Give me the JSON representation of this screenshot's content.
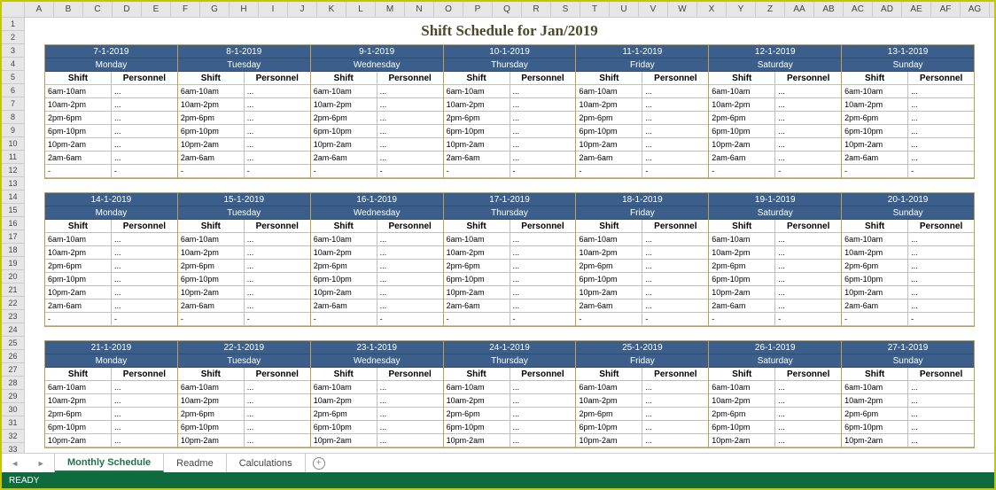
{
  "title": "Shift Schedule for Jan/2019",
  "columns": [
    "A",
    "B",
    "C",
    "D",
    "E",
    "F",
    "G",
    "H",
    "I",
    "J",
    "K",
    "L",
    "M",
    "N",
    "O",
    "P",
    "Q",
    "R",
    "S",
    "T",
    "U",
    "V",
    "W",
    "X",
    "Y",
    "Z",
    "AA",
    "AB",
    "AC",
    "AD",
    "AE",
    "AF",
    "AG"
  ],
  "rows_visible": 33,
  "col_hdrs": {
    "shift": "Shift",
    "personnel": "Personnel"
  },
  "shifts_full": [
    "6am-10am",
    "10am-2pm",
    "2pm-6pm",
    "6pm-10pm",
    "10pm-2am",
    "2am-6am",
    "-"
  ],
  "shifts_partial": [
    "6am-10am",
    "10am-2pm",
    "2pm-6pm",
    "6pm-10pm",
    "10pm-2am"
  ],
  "personnel_placeholder": "...",
  "dash": "-",
  "weeks": [
    {
      "days": [
        {
          "date": "7-1-2019",
          "name": "Monday"
        },
        {
          "date": "8-1-2019",
          "name": "Tuesday"
        },
        {
          "date": "9-1-2019",
          "name": "Wednesday"
        },
        {
          "date": "10-1-2019",
          "name": "Thursday"
        },
        {
          "date": "11-1-2019",
          "name": "Friday"
        },
        {
          "date": "12-1-2019",
          "name": "Saturday"
        },
        {
          "date": "13-1-2019",
          "name": "Sunday"
        }
      ],
      "extra_dash_row": true
    },
    {
      "days": [
        {
          "date": "14-1-2019",
          "name": "Monday"
        },
        {
          "date": "15-1-2019",
          "name": "Tuesday"
        },
        {
          "date": "16-1-2019",
          "name": "Wednesday"
        },
        {
          "date": "17-1-2019",
          "name": "Thursday"
        },
        {
          "date": "18-1-2019",
          "name": "Friday"
        },
        {
          "date": "19-1-2019",
          "name": "Saturday"
        },
        {
          "date": "20-1-2019",
          "name": "Sunday"
        }
      ],
      "extra_dash_row": false
    },
    {
      "days": [
        {
          "date": "21-1-2019",
          "name": "Monday"
        },
        {
          "date": "22-1-2019",
          "name": "Tuesday"
        },
        {
          "date": "23-1-2019",
          "name": "Wednesday"
        },
        {
          "date": "24-1-2019",
          "name": "Thursday"
        },
        {
          "date": "25-1-2019",
          "name": "Friday"
        },
        {
          "date": "26-1-2019",
          "name": "Saturday"
        },
        {
          "date": "27-1-2019",
          "name": "Sunday"
        }
      ],
      "partial": true
    }
  ],
  "tabs": [
    {
      "label": "Monthly Schedule",
      "active": true
    },
    {
      "label": "Readme",
      "active": false
    },
    {
      "label": "Calculations",
      "active": false
    }
  ],
  "status": "READY"
}
